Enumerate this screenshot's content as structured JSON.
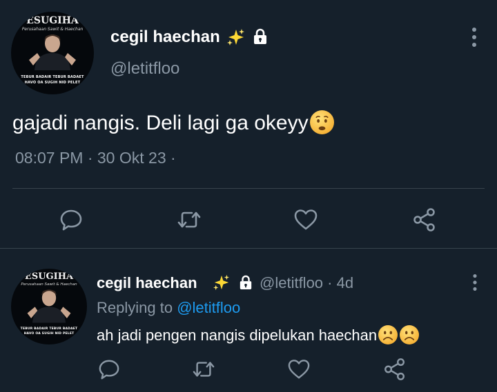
{
  "main_tweet": {
    "avatar": {
      "brand": "ESUGIHA",
      "tagline": "Perusahaan Sawit & Haechan",
      "caption_line1": "TEBUR BADAIR TEBUR BADAET",
      "caption_line2": "HAVO OA SUGIH NID PELET"
    },
    "author_name": "cegil haechan",
    "author_handle": "@letitfloo",
    "text": "gajadi nangis. Deli lagi ga okeyy",
    "timestamp": "08:07 PM · 30 Okt 23 ·"
  },
  "reply_tweet": {
    "avatar": {
      "brand": "ESUGIHA",
      "tagline": "Perusahaan Sawit & Haechan",
      "caption_line1": "TEBUR BADAIR TEBUR BADAET",
      "caption_line2": "HAVO OA SUGIH NID PELET"
    },
    "author_name": "cegil haechan",
    "handle_time": "@letitfloo · 4d",
    "replying_prefix": "Replying to",
    "replying_handle": "@letitfloo",
    "text": "ah jadi pengen nangis dipelukan haechan"
  },
  "icons": {
    "sparkle": "sparkles-icon",
    "lock": "lock-icon",
    "more": "more-vertical-icon",
    "reply": "reply-icon",
    "retweet": "retweet-icon",
    "like": "heart-icon",
    "share": "share-icon"
  },
  "colors": {
    "background": "#15202b",
    "text": "#ffffff",
    "muted": "#8b98a5",
    "link": "#1d9bf0",
    "divider": "#38444d"
  }
}
